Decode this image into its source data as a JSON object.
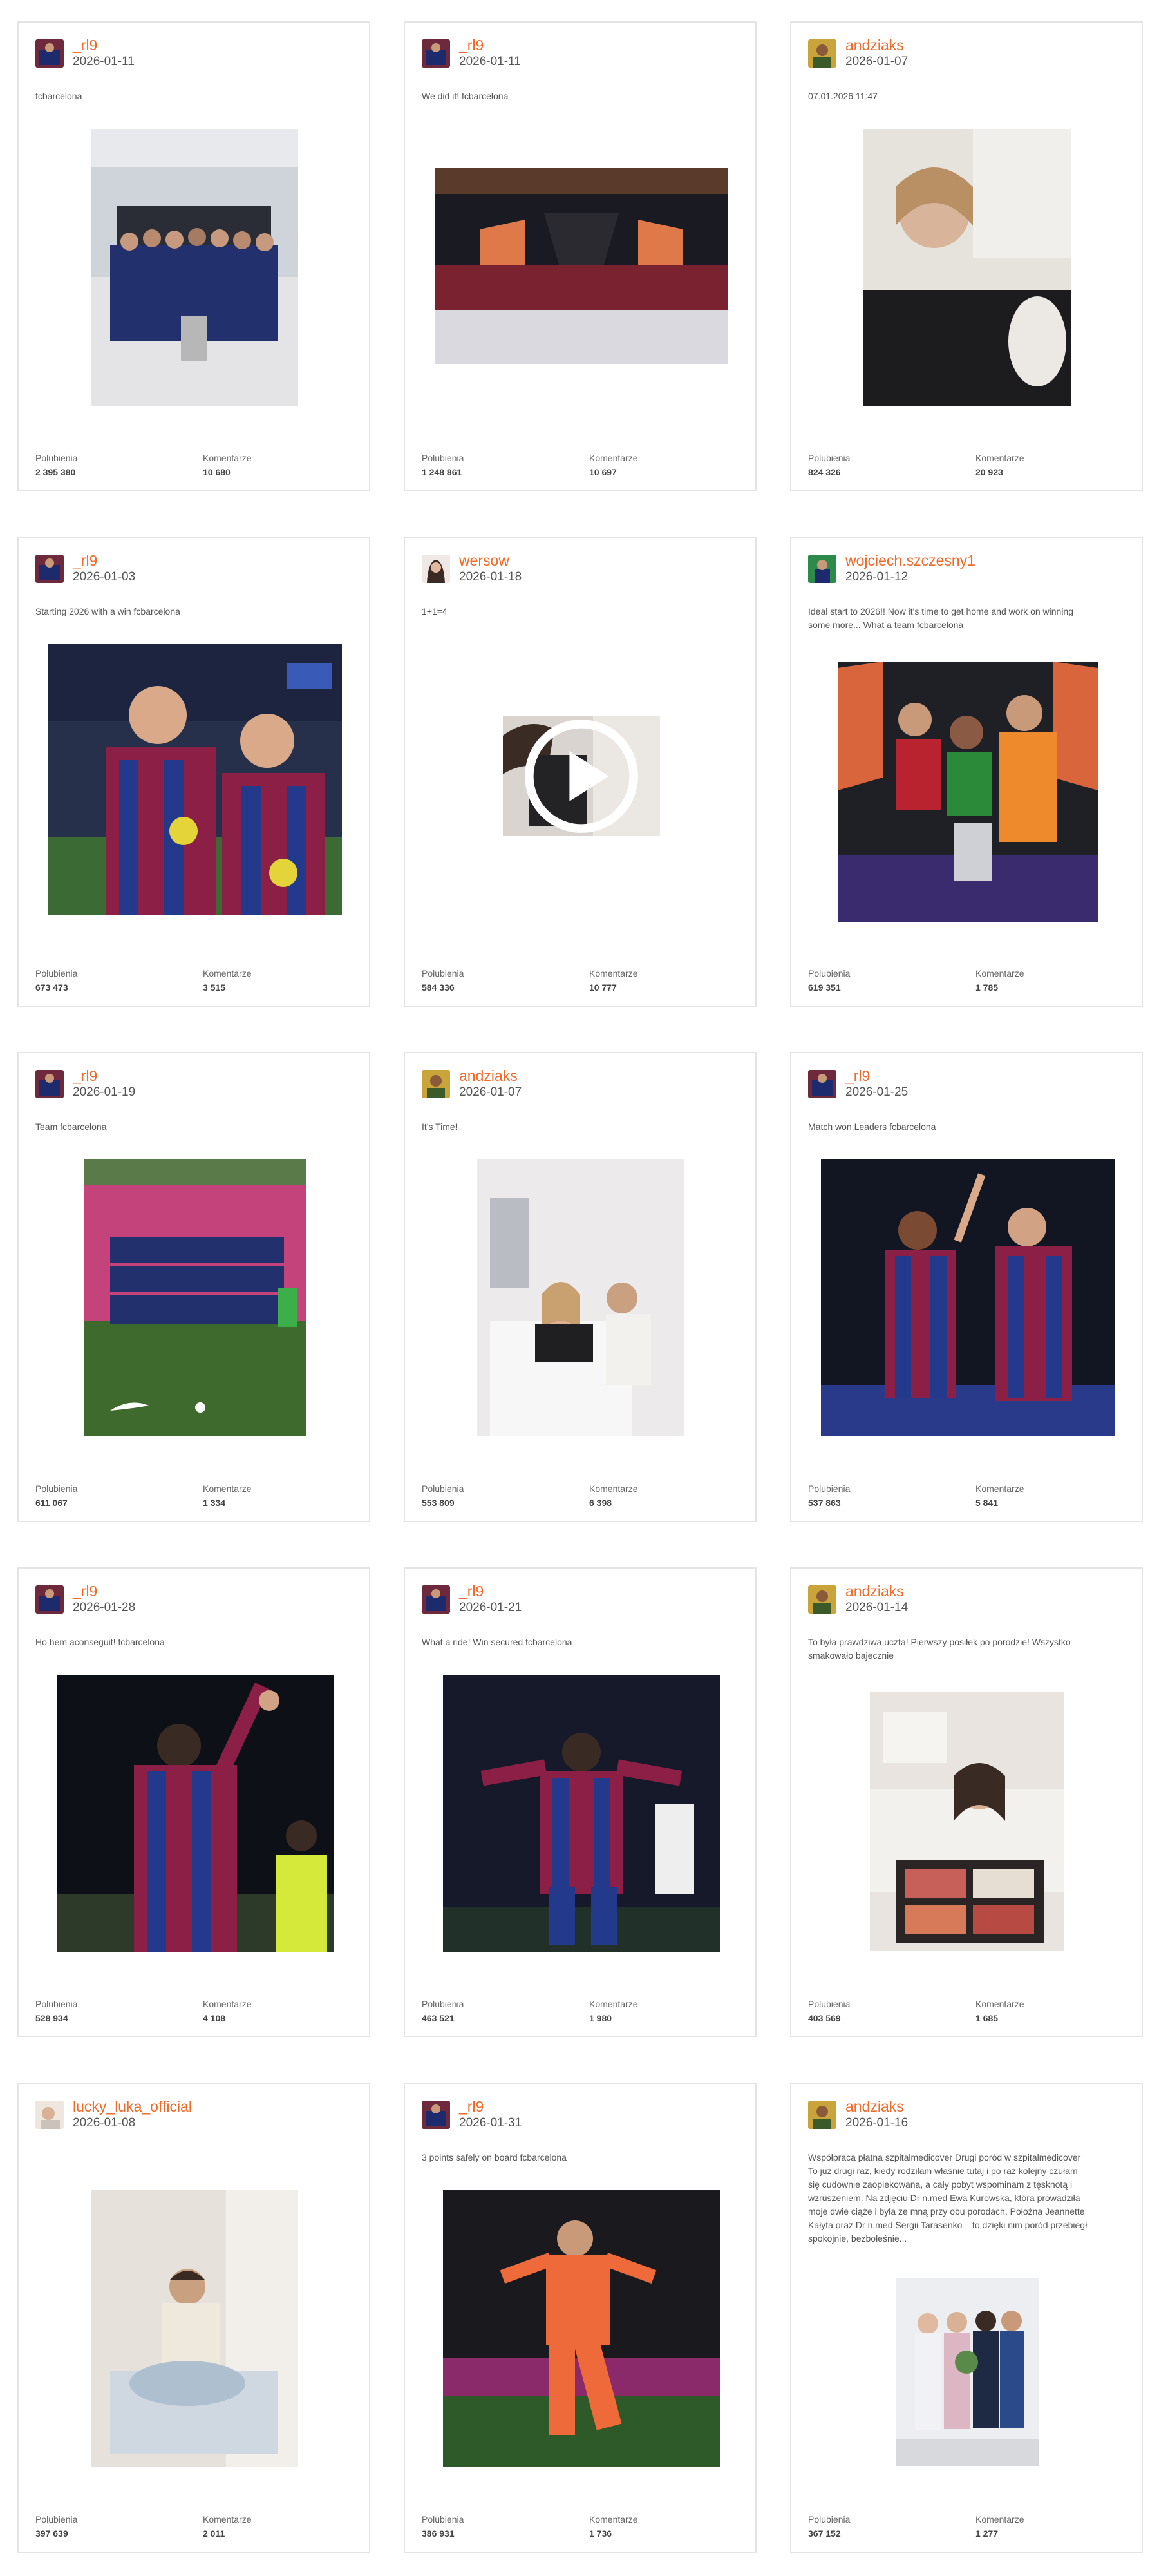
{
  "posts": [
    {
      "user": "_rl9",
      "date": "2026-01-11",
      "caption": "fcbarcelona",
      "likes_label": "Polubienia",
      "likes": "2 395 380",
      "comments_label": "Komentarze",
      "comments": "10 680"
    },
    {
      "user": "_rl9",
      "date": "2026-01-11",
      "caption": "We did it! fcbarcelona",
      "likes_label": "Polubienia",
      "likes": "1 248 861",
      "comments_label": "Komentarze",
      "comments": "10 697"
    },
    {
      "user": "andziaks",
      "date": "2026-01-07",
      "caption": "07.01.2026 11:47",
      "likes_label": "Polubienia",
      "likes": "824 326",
      "comments_label": "Komentarze",
      "comments": "20 923"
    },
    {
      "user": "_rl9",
      "date": "2026-01-03",
      "caption": "Starting 2026 with a win fcbarcelona",
      "likes_label": "Polubienia",
      "likes": "673 473",
      "comments_label": "Komentarze",
      "comments": "3 515"
    },
    {
      "user": "wersow",
      "date": "2026-01-18",
      "caption": "1+1=4",
      "likes_label": "Polubienia",
      "likes": "584 336",
      "comments_label": "Komentarze",
      "comments": "10 777"
    },
    {
      "user": "wojciech.szczesny1",
      "date": "2026-01-12",
      "caption": "Ideal start to 2026!! Now it's time to get home and work on winning some more... What a team fcbarcelona",
      "likes_label": "Polubienia",
      "likes": "619 351",
      "comments_label": "Komentarze",
      "comments": "1 785"
    },
    {
      "user": "_rl9",
      "date": "2026-01-19",
      "caption": "Team fcbarcelona",
      "likes_label": "Polubienia",
      "likes": "611 067",
      "comments_label": "Komentarze",
      "comments": "1 334"
    },
    {
      "user": "andziaks",
      "date": "2026-01-07",
      "caption": "It's Time!",
      "likes_label": "Polubienia",
      "likes": "553 809",
      "comments_label": "Komentarze",
      "comments": "6 398"
    },
    {
      "user": "_rl9",
      "date": "2026-01-25",
      "caption": "Match won.Leaders fcbarcelona",
      "likes_label": "Polubienia",
      "likes": "537 863",
      "comments_label": "Komentarze",
      "comments": "5 841"
    },
    {
      "user": "_rl9",
      "date": "2026-01-28",
      "caption": "Ho hem aconseguit! fcbarcelona",
      "likes_label": "Polubienia",
      "likes": "528 934",
      "comments_label": "Komentarze",
      "comments": "4 108"
    },
    {
      "user": "_rl9",
      "date": "2026-01-21",
      "caption": "What a ride! Win secured fcbarcelona",
      "likes_label": "Polubienia",
      "likes": "463 521",
      "comments_label": "Komentarze",
      "comments": "1 980"
    },
    {
      "user": "andziaks",
      "date": "2026-01-14",
      "caption": "To była prawdziwa uczta! Pierwszy posiłek po porodzie! Wszystko smakowało bajecznie",
      "likes_label": "Polubienia",
      "likes": "403 569",
      "comments_label": "Komentarze",
      "comments": "1 685"
    },
    {
      "user": "lucky_luka_official",
      "date": "2026-01-08",
      "caption": "",
      "likes_label": "Polubienia",
      "likes": "397 639",
      "comments_label": "Komentarze",
      "comments": "2 011"
    },
    {
      "user": "_rl9",
      "date": "2026-01-31",
      "caption": "3 points safely on board fcbarcelona",
      "likes_label": "Polubienia",
      "likes": "386 931",
      "comments_label": "Komentarze",
      "comments": "1 736"
    },
    {
      "user": "andziaks",
      "date": "2026-01-16",
      "caption": "Współpraca płatna szpitalmedicover Drugi poród w szpitalmedicover To już drugi raz, kiedy rodziłam właśnie tutaj i po raz kolejny czułam się cudownie zaopiekowana, a cały pobyt wspominam z tęsknotą i wzruszeniem. Na zdjęciu Dr n.med Ewa Kurowska, która prowadziła moje dwie ciąże i była ze mną przy obu porodach, Położna Jeannette Kałyta oraz Dr n.med Sergii Tarasenko – to dzięki nim poród przebiegł spokojnie, bezboleśnie...",
      "likes_label": "Polubienia",
      "likes": "367 152",
      "comments_label": "Komentarze",
      "comments": "1 277"
    }
  ],
  "theme": {
    "accent": "#f06a2a",
    "border": "#e4e4e4"
  }
}
